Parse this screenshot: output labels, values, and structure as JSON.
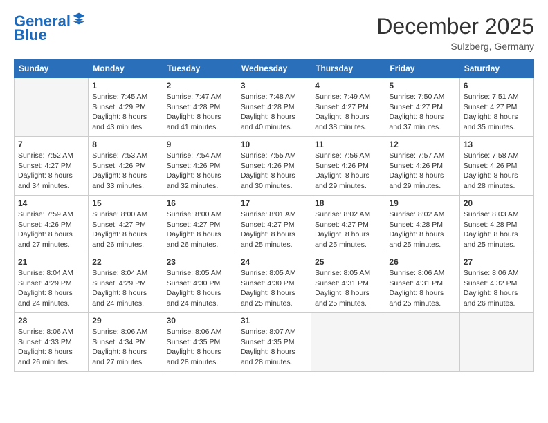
{
  "logo": {
    "line1": "General",
    "line2": "Blue"
  },
  "title": "December 2025",
  "location": "Sulzberg, Germany",
  "weekdays": [
    "Sunday",
    "Monday",
    "Tuesday",
    "Wednesday",
    "Thursday",
    "Friday",
    "Saturday"
  ],
  "days": [
    {
      "num": "",
      "sunrise": "",
      "sunset": "",
      "daylight": ""
    },
    {
      "num": "1",
      "sunrise": "Sunrise: 7:45 AM",
      "sunset": "Sunset: 4:29 PM",
      "daylight": "Daylight: 8 hours and 43 minutes."
    },
    {
      "num": "2",
      "sunrise": "Sunrise: 7:47 AM",
      "sunset": "Sunset: 4:28 PM",
      "daylight": "Daylight: 8 hours and 41 minutes."
    },
    {
      "num": "3",
      "sunrise": "Sunrise: 7:48 AM",
      "sunset": "Sunset: 4:28 PM",
      "daylight": "Daylight: 8 hours and 40 minutes."
    },
    {
      "num": "4",
      "sunrise": "Sunrise: 7:49 AM",
      "sunset": "Sunset: 4:27 PM",
      "daylight": "Daylight: 8 hours and 38 minutes."
    },
    {
      "num": "5",
      "sunrise": "Sunrise: 7:50 AM",
      "sunset": "Sunset: 4:27 PM",
      "daylight": "Daylight: 8 hours and 37 minutes."
    },
    {
      "num": "6",
      "sunrise": "Sunrise: 7:51 AM",
      "sunset": "Sunset: 4:27 PM",
      "daylight": "Daylight: 8 hours and 35 minutes."
    },
    {
      "num": "7",
      "sunrise": "Sunrise: 7:52 AM",
      "sunset": "Sunset: 4:27 PM",
      "daylight": "Daylight: 8 hours and 34 minutes."
    },
    {
      "num": "8",
      "sunrise": "Sunrise: 7:53 AM",
      "sunset": "Sunset: 4:26 PM",
      "daylight": "Daylight: 8 hours and 33 minutes."
    },
    {
      "num": "9",
      "sunrise": "Sunrise: 7:54 AM",
      "sunset": "Sunset: 4:26 PM",
      "daylight": "Daylight: 8 hours and 32 minutes."
    },
    {
      "num": "10",
      "sunrise": "Sunrise: 7:55 AM",
      "sunset": "Sunset: 4:26 PM",
      "daylight": "Daylight: 8 hours and 30 minutes."
    },
    {
      "num": "11",
      "sunrise": "Sunrise: 7:56 AM",
      "sunset": "Sunset: 4:26 PM",
      "daylight": "Daylight: 8 hours and 29 minutes."
    },
    {
      "num": "12",
      "sunrise": "Sunrise: 7:57 AM",
      "sunset": "Sunset: 4:26 PM",
      "daylight": "Daylight: 8 hours and 29 minutes."
    },
    {
      "num": "13",
      "sunrise": "Sunrise: 7:58 AM",
      "sunset": "Sunset: 4:26 PM",
      "daylight": "Daylight: 8 hours and 28 minutes."
    },
    {
      "num": "14",
      "sunrise": "Sunrise: 7:59 AM",
      "sunset": "Sunset: 4:26 PM",
      "daylight": "Daylight: 8 hours and 27 minutes."
    },
    {
      "num": "15",
      "sunrise": "Sunrise: 8:00 AM",
      "sunset": "Sunset: 4:27 PM",
      "daylight": "Daylight: 8 hours and 26 minutes."
    },
    {
      "num": "16",
      "sunrise": "Sunrise: 8:00 AM",
      "sunset": "Sunset: 4:27 PM",
      "daylight": "Daylight: 8 hours and 26 minutes."
    },
    {
      "num": "17",
      "sunrise": "Sunrise: 8:01 AM",
      "sunset": "Sunset: 4:27 PM",
      "daylight": "Daylight: 8 hours and 25 minutes."
    },
    {
      "num": "18",
      "sunrise": "Sunrise: 8:02 AM",
      "sunset": "Sunset: 4:27 PM",
      "daylight": "Daylight: 8 hours and 25 minutes."
    },
    {
      "num": "19",
      "sunrise": "Sunrise: 8:02 AM",
      "sunset": "Sunset: 4:28 PM",
      "daylight": "Daylight: 8 hours and 25 minutes."
    },
    {
      "num": "20",
      "sunrise": "Sunrise: 8:03 AM",
      "sunset": "Sunset: 4:28 PM",
      "daylight": "Daylight: 8 hours and 25 minutes."
    },
    {
      "num": "21",
      "sunrise": "Sunrise: 8:04 AM",
      "sunset": "Sunset: 4:29 PM",
      "daylight": "Daylight: 8 hours and 24 minutes."
    },
    {
      "num": "22",
      "sunrise": "Sunrise: 8:04 AM",
      "sunset": "Sunset: 4:29 PM",
      "daylight": "Daylight: 8 hours and 24 minutes."
    },
    {
      "num": "23",
      "sunrise": "Sunrise: 8:05 AM",
      "sunset": "Sunset: 4:30 PM",
      "daylight": "Daylight: 8 hours and 24 minutes."
    },
    {
      "num": "24",
      "sunrise": "Sunrise: 8:05 AM",
      "sunset": "Sunset: 4:30 PM",
      "daylight": "Daylight: 8 hours and 25 minutes."
    },
    {
      "num": "25",
      "sunrise": "Sunrise: 8:05 AM",
      "sunset": "Sunset: 4:31 PM",
      "daylight": "Daylight: 8 hours and 25 minutes."
    },
    {
      "num": "26",
      "sunrise": "Sunrise: 8:06 AM",
      "sunset": "Sunset: 4:31 PM",
      "daylight": "Daylight: 8 hours and 25 minutes."
    },
    {
      "num": "27",
      "sunrise": "Sunrise: 8:06 AM",
      "sunset": "Sunset: 4:32 PM",
      "daylight": "Daylight: 8 hours and 26 minutes."
    },
    {
      "num": "28",
      "sunrise": "Sunrise: 8:06 AM",
      "sunset": "Sunset: 4:33 PM",
      "daylight": "Daylight: 8 hours and 26 minutes."
    },
    {
      "num": "29",
      "sunrise": "Sunrise: 8:06 AM",
      "sunset": "Sunset: 4:34 PM",
      "daylight": "Daylight: 8 hours and 27 minutes."
    },
    {
      "num": "30",
      "sunrise": "Sunrise: 8:06 AM",
      "sunset": "Sunset: 4:35 PM",
      "daylight": "Daylight: 8 hours and 28 minutes."
    },
    {
      "num": "31",
      "sunrise": "Sunrise: 8:07 AM",
      "sunset": "Sunset: 4:35 PM",
      "daylight": "Daylight: 8 hours and 28 minutes."
    }
  ]
}
